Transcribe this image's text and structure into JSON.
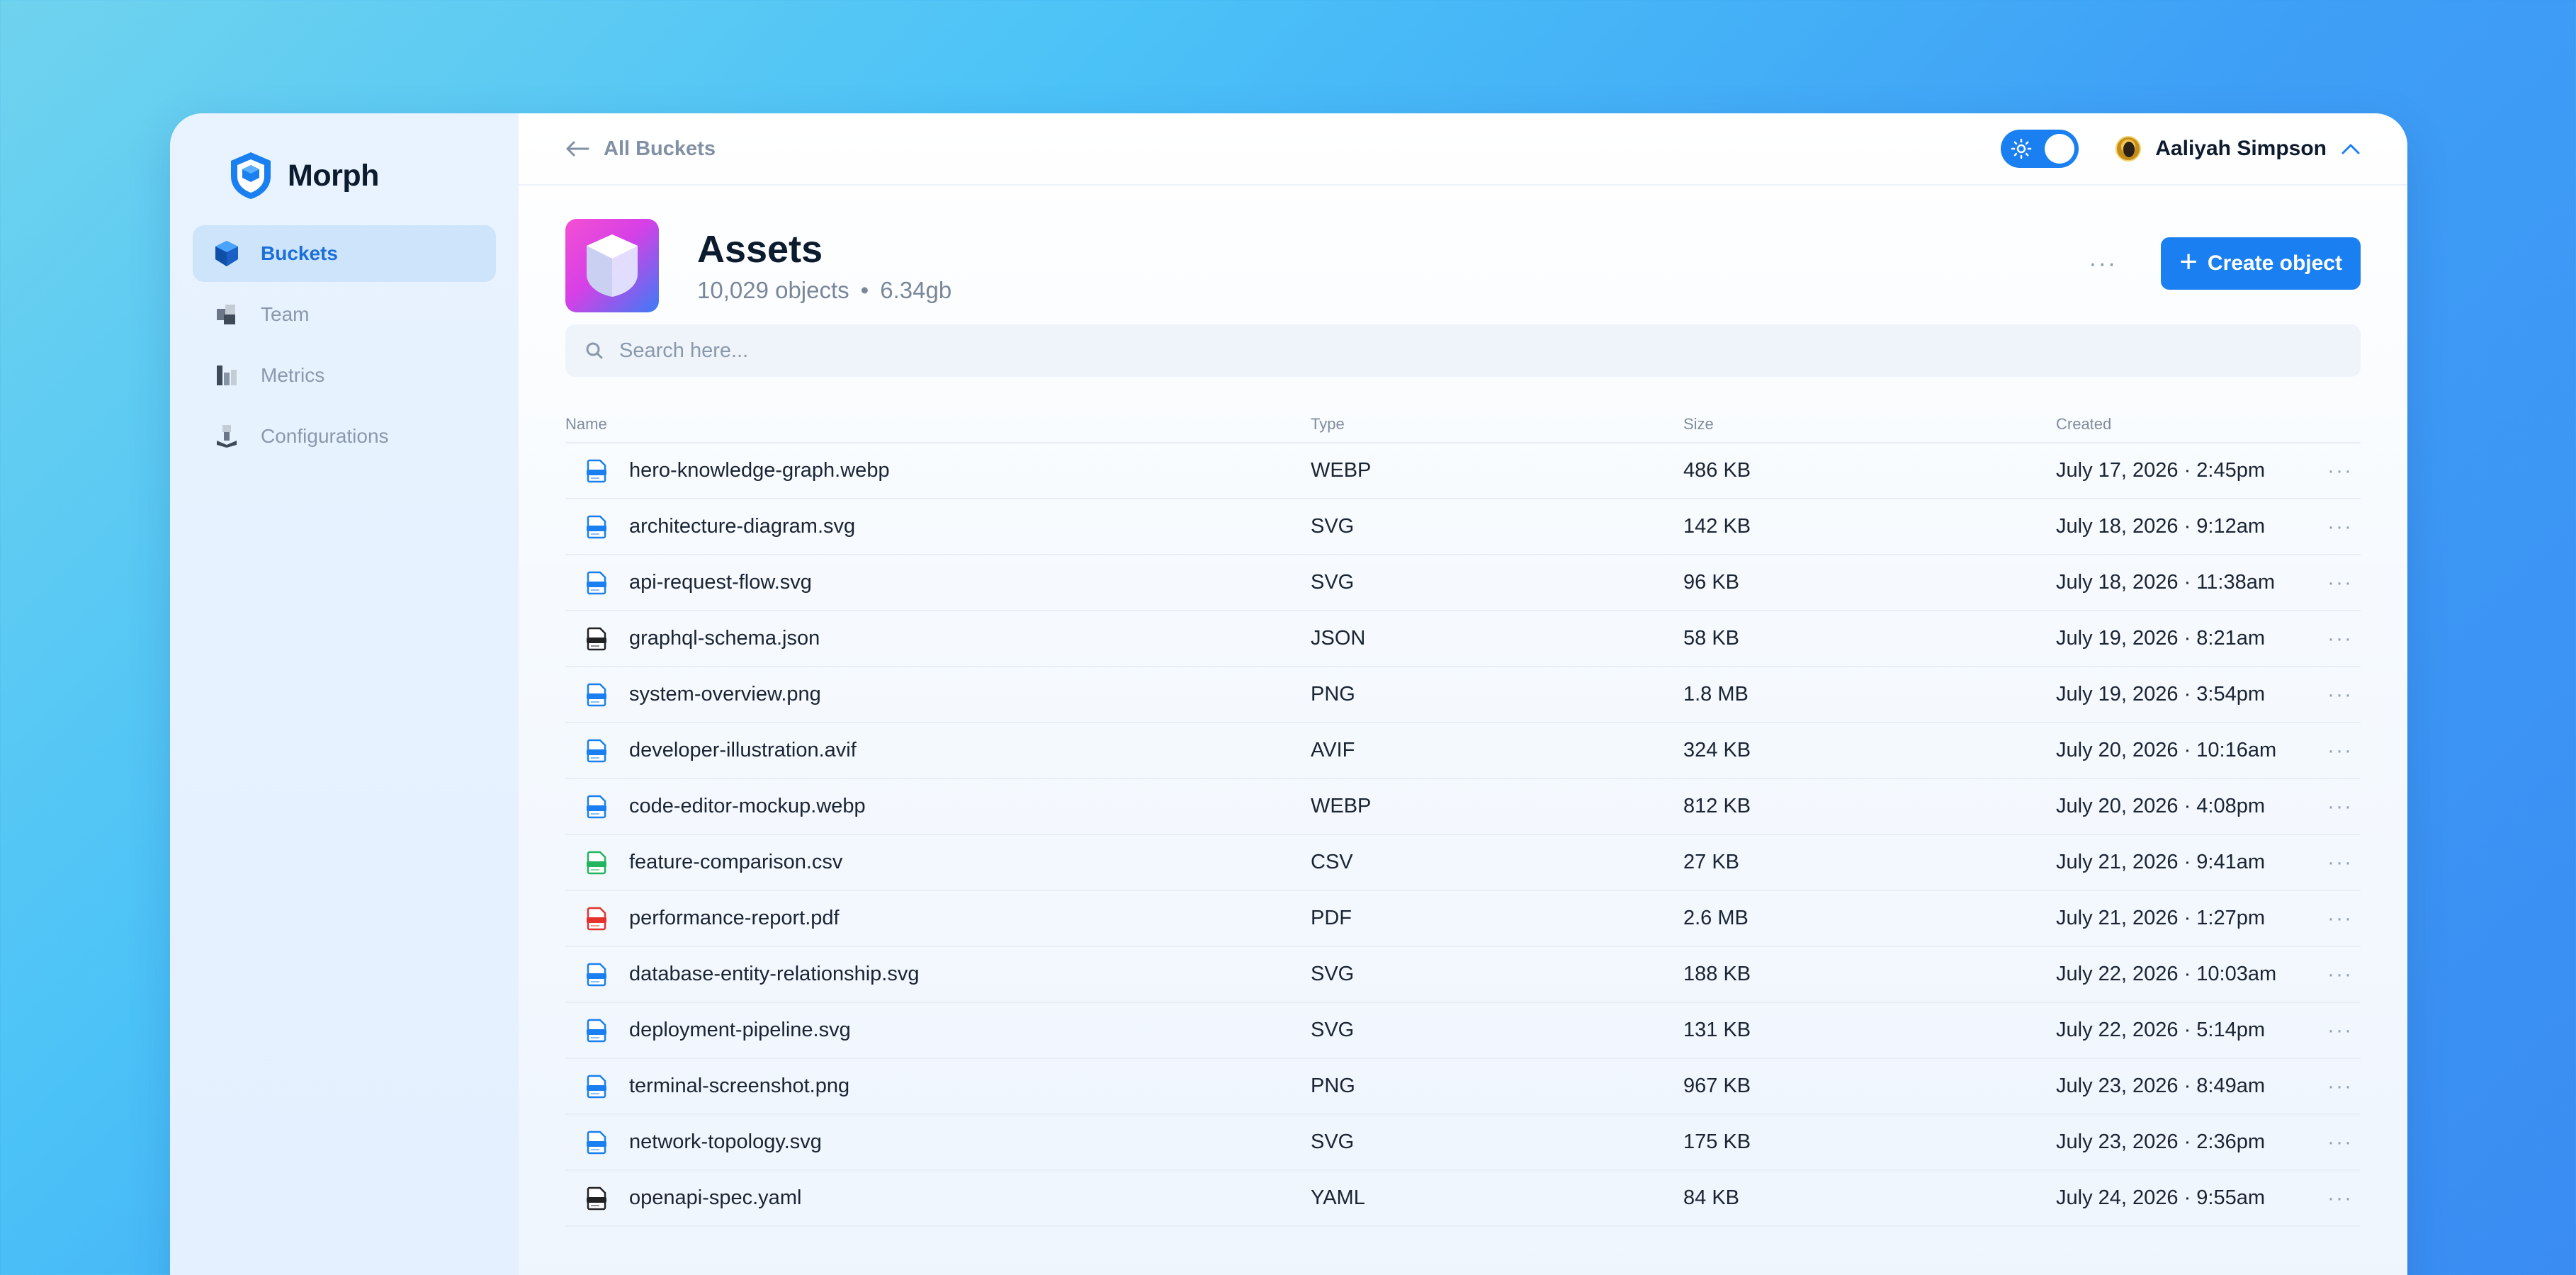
{
  "brand": {
    "name": "Morph",
    "logo_icon": "shield-logo-icon"
  },
  "sidebar": {
    "items": [
      {
        "label": "Buckets",
        "icon": "bucket-icon",
        "active": true
      },
      {
        "label": "Team",
        "icon": "team-icon",
        "active": false
      },
      {
        "label": "Metrics",
        "icon": "metrics-icon",
        "active": false
      },
      {
        "label": "Configurations",
        "icon": "configurations-icon",
        "active": false
      }
    ]
  },
  "topbar": {
    "back_label": "All Buckets",
    "theme_toggle": {
      "state": "light",
      "icon": "sun-icon"
    },
    "user": {
      "name": "Aaliyah Simpson",
      "icon": "chevron-up-icon"
    }
  },
  "bucket": {
    "title": "Assets",
    "objects": "10,029 objects",
    "separator": "•",
    "size": "6.34gb",
    "more_label": "···",
    "create_plus": "+",
    "create_label": "Create object"
  },
  "search": {
    "placeholder": "Search here..."
  },
  "table": {
    "headers": {
      "name": "Name",
      "type": "Type",
      "size": "Size",
      "created": "Created"
    },
    "row_action": "···",
    "rows": [
      {
        "name": "hero-knowledge-graph.webp",
        "type": "WEBP",
        "size": "486 KB",
        "created": "July 17, 2026 · 2:45pm",
        "color": "#1a7ff0"
      },
      {
        "name": "architecture-diagram.svg",
        "type": "SVG",
        "size": "142 KB",
        "created": "July 18, 2026 · 9:12am",
        "color": "#1a7ff0"
      },
      {
        "name": "api-request-flow.svg",
        "type": "SVG",
        "size": "96 KB",
        "created": "July 18, 2026 · 11:38am",
        "color": "#1a7ff0"
      },
      {
        "name": "graphql-schema.json",
        "type": "JSON",
        "size": "58 KB",
        "created": "July 19, 2026 · 8:21am",
        "color": "#222222"
      },
      {
        "name": "system-overview.png",
        "type": "PNG",
        "size": "1.8 MB",
        "created": "July 19, 2026 · 3:54pm",
        "color": "#1a7ff0"
      },
      {
        "name": "developer-illustration.avif",
        "type": "AVIF",
        "size": "324 KB",
        "created": "July 20, 2026 · 10:16am",
        "color": "#1a7ff0"
      },
      {
        "name": "code-editor-mockup.webp",
        "type": "WEBP",
        "size": "812 KB",
        "created": "July 20, 2026 · 4:08pm",
        "color": "#1a7ff0"
      },
      {
        "name": "feature-comparison.csv",
        "type": "CSV",
        "size": "27 KB",
        "created": "July 21, 2026 · 9:41am",
        "color": "#22b45e"
      },
      {
        "name": "performance-report.pdf",
        "type": "PDF",
        "size": "2.6 MB",
        "created": "July 21, 2026 · 1:27pm",
        "color": "#e5322d"
      },
      {
        "name": "database-entity-relationship.svg",
        "type": "SVG",
        "size": "188 KB",
        "created": "July 22, 2026 · 10:03am",
        "color": "#1a7ff0"
      },
      {
        "name": "deployment-pipeline.svg",
        "type": "SVG",
        "size": "131 KB",
        "created": "July 22, 2026 · 5:14pm",
        "color": "#1a7ff0"
      },
      {
        "name": "terminal-screenshot.png",
        "type": "PNG",
        "size": "967 KB",
        "created": "July 23, 2026 · 8:49am",
        "color": "#1a7ff0"
      },
      {
        "name": "network-topology.svg",
        "type": "SVG",
        "size": "175 KB",
        "created": "July 23, 2026 · 2:36pm",
        "color": "#1a7ff0"
      },
      {
        "name": "openapi-spec.yaml",
        "type": "YAML",
        "size": "84 KB",
        "created": "July 24, 2026 · 9:55am",
        "color": "#222222"
      }
    ]
  }
}
